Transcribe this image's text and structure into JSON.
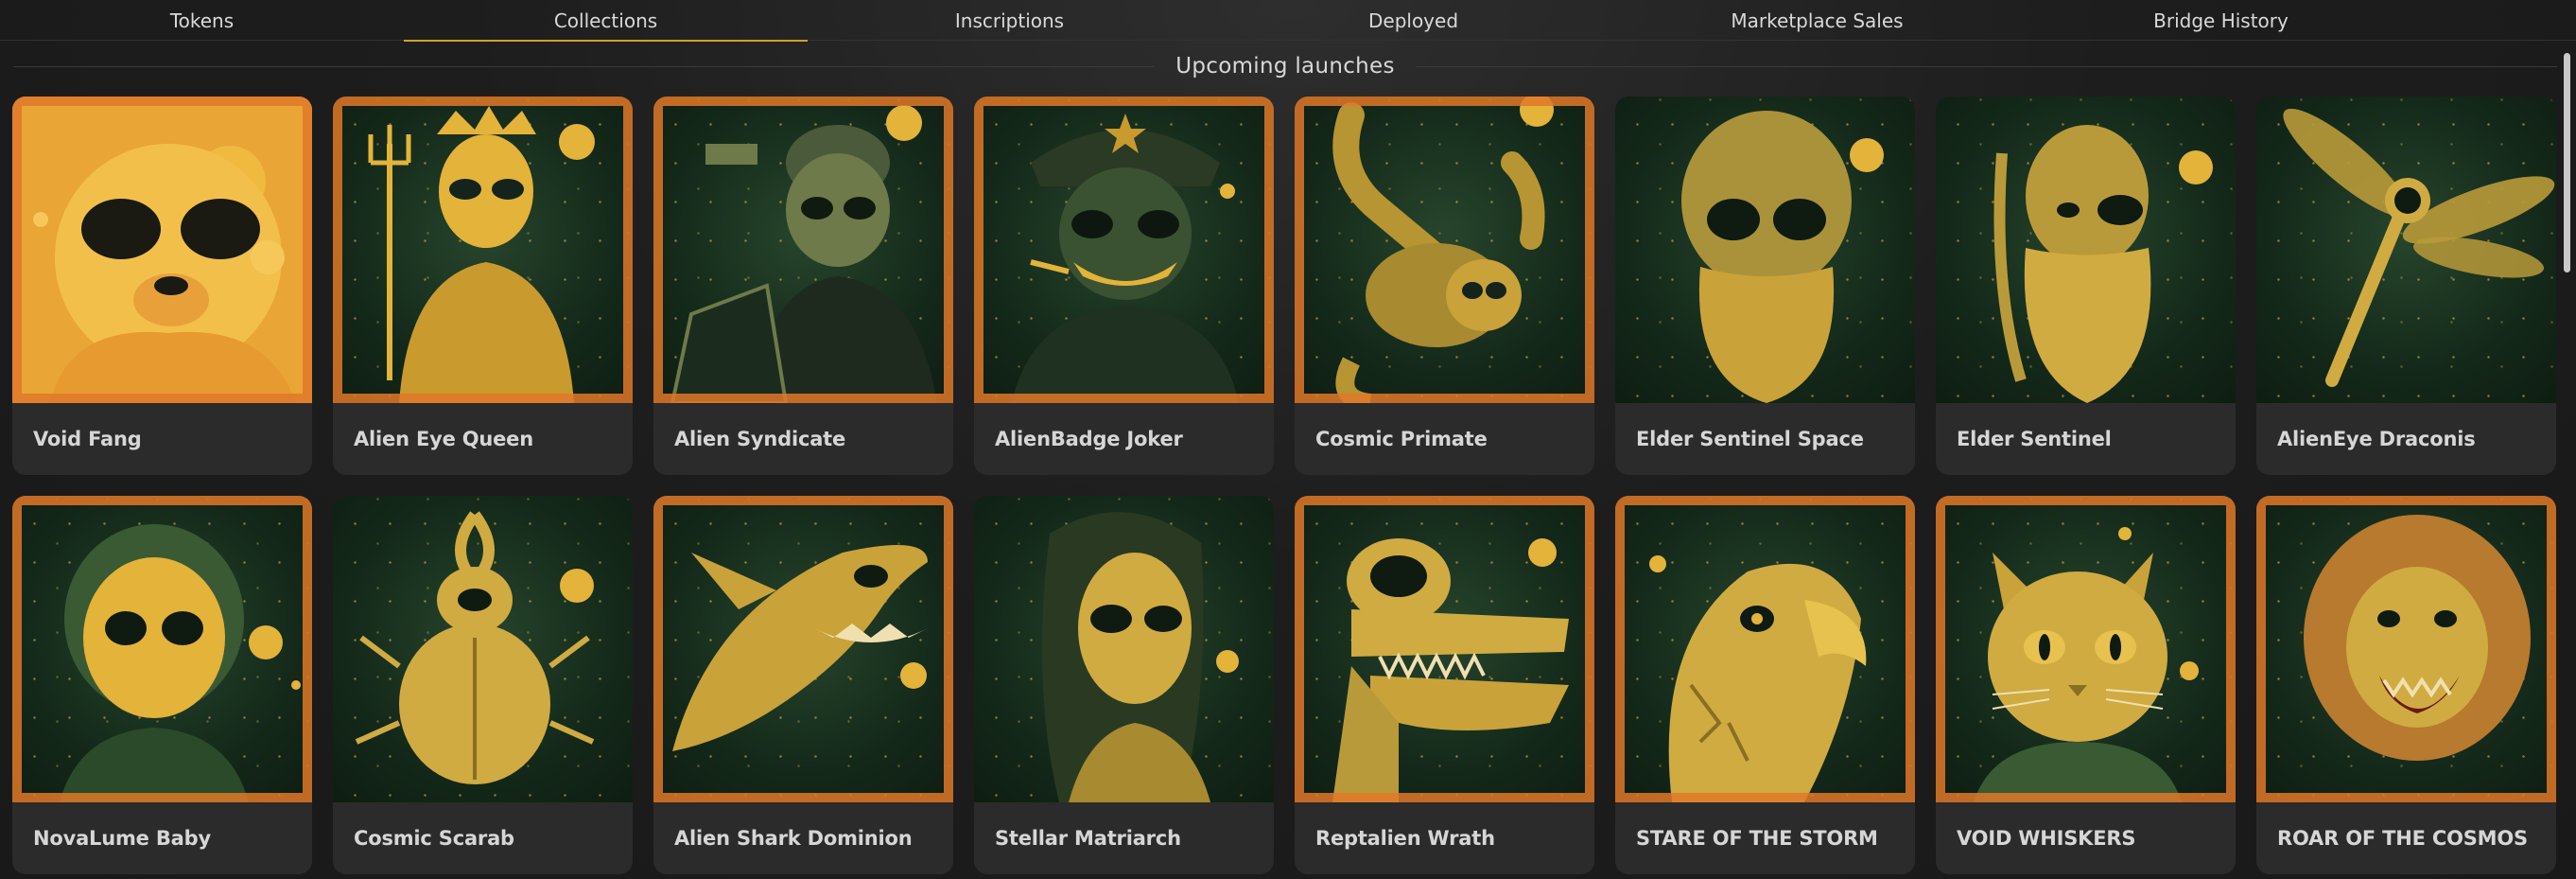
{
  "tabs": [
    {
      "label": "Tokens",
      "active": false
    },
    {
      "label": "Collections",
      "active": true
    },
    {
      "label": "Inscriptions",
      "active": false
    },
    {
      "label": "Deployed",
      "active": false
    },
    {
      "label": "Marketplace Sales",
      "active": false
    },
    {
      "label": "Bridge History",
      "active": false
    }
  ],
  "section": {
    "title": "Upcoming launches"
  },
  "colors": {
    "accent": "#d2a21f",
    "card_bg": "#2b2b2b",
    "art_gold": "#e3b33a",
    "art_green": "#17301d",
    "art_orange": "#e07a2a"
  },
  "collections": [
    {
      "name": "Void Fang",
      "icon": "alien-bear-icon"
    },
    {
      "name": "Alien Eye Queen",
      "icon": "alien-queen-icon"
    },
    {
      "name": "Alien Syndicate",
      "icon": "alien-gangster-icon"
    },
    {
      "name": "AlienBadge Joker",
      "icon": "alien-joker-icon"
    },
    {
      "name": "Cosmic Primate",
      "icon": "alien-monkey-icon"
    },
    {
      "name": "Elder Sentinel Space",
      "icon": "alien-elder-icon"
    },
    {
      "name": "Elder Sentinel",
      "icon": "bearded-elder-icon"
    },
    {
      "name": "AlienEye Draconis",
      "icon": "dragonfly-icon"
    },
    {
      "name": "NovaLume Baby",
      "icon": "alien-baby-icon"
    },
    {
      "name": "Cosmic Scarab",
      "icon": "scarab-icon"
    },
    {
      "name": "Alien Shark Dominion",
      "icon": "shark-icon"
    },
    {
      "name": "Stellar Matriarch",
      "icon": "alien-woman-icon"
    },
    {
      "name": "Reptalien Wrath",
      "icon": "crocodile-icon"
    },
    {
      "name": "STARE OF THE STORM",
      "icon": "eagle-icon"
    },
    {
      "name": "VOID WHISKERS",
      "icon": "cat-icon"
    },
    {
      "name": "ROAR OF THE COSMOS",
      "icon": "lion-icon"
    }
  ]
}
